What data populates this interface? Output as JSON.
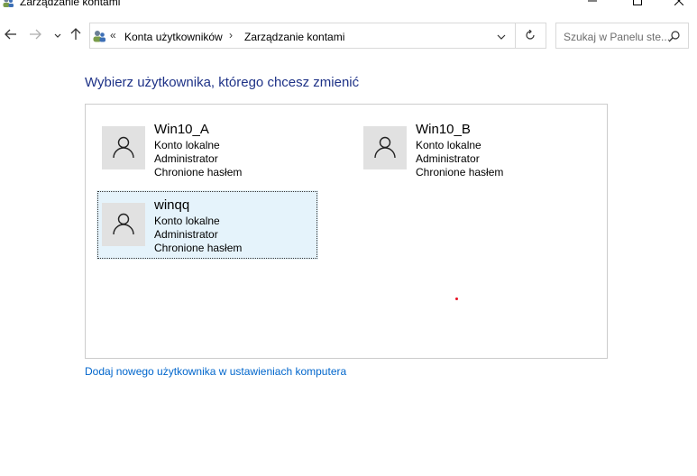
{
  "window": {
    "title": "Zarządzanie kontami",
    "icons": {
      "app": "user-accounts-icon",
      "minimize": "minimize-icon",
      "maximize": "maximize-icon",
      "close": "close-icon"
    }
  },
  "nav": {
    "icons": {
      "back": "arrow-left-icon",
      "forward": "arrow-right-icon",
      "recent": "chevron-down-icon",
      "up": "arrow-up-icon"
    }
  },
  "address": {
    "overflow": "«",
    "separator": "›",
    "breadcrumbs": [
      "Konta użytkowników",
      "Zarządzanie kontami"
    ],
    "icons": {
      "location": "user-accounts-icon",
      "dropdown": "chevron-down-icon",
      "refresh": "refresh-icon"
    }
  },
  "search": {
    "placeholder": "Szukaj w Panelu ste...",
    "icon": "search-icon"
  },
  "main": {
    "heading": "Wybierz użytkownika, którego chcesz zmienić",
    "accounts": [
      {
        "name": "Win10_A",
        "lines": [
          "Konto lokalne",
          "Administrator",
          "Chronione hasłem"
        ],
        "selected": false
      },
      {
        "name": "Win10_B",
        "lines": [
          "Konto lokalne",
          "Administrator",
          "Chronione hasłem"
        ],
        "selected": false
      },
      {
        "name": "winqq",
        "lines": [
          "Konto lokalne",
          "Administrator",
          "Chronione hasłem"
        ],
        "selected": true
      }
    ],
    "add_user_link": "Dodaj nowego użytkownika w ustawieniach komputera"
  },
  "colors": {
    "heading": "#1e3287",
    "link": "#0066cc",
    "selection_bg": "#e5f3fb",
    "avatar_bg": "#e1e1e1"
  }
}
